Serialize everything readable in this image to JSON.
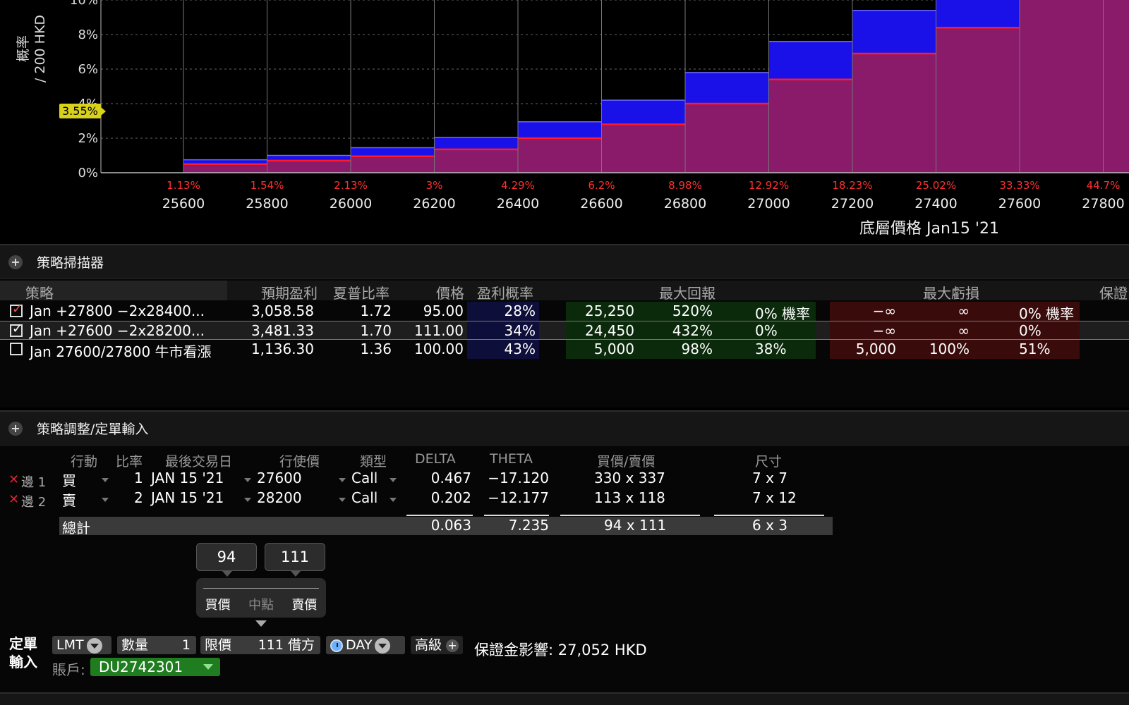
{
  "chart": {
    "y_label_line1": "概率",
    "y_label_line2": "/ 200 HKD",
    "pointer_value": "3.55%",
    "x_label": "底層價格 Jan15 '21",
    "y_ticks": [
      "0%",
      "2%",
      "4%",
      "6%",
      "8%",
      "10%"
    ],
    "x_ticks": [
      "25600",
      "25800",
      "26000",
      "26200",
      "26400",
      "26600",
      "26800",
      "27000",
      "27200",
      "27400",
      "27600",
      "27800"
    ],
    "cum_probs": [
      "1.13%",
      "1.54%",
      "2.13%",
      "3%",
      "4.29%",
      "6.2%",
      "8.98%",
      "12.92%",
      "18.23%",
      "25.02%",
      "33.33%",
      "44.7%"
    ],
    "colors": {
      "purple": "#8a1a6a",
      "blue": "#1a10e8",
      "red_line": "#ff1a2a",
      "grid": "#666",
      "cum_label": "#ff3030"
    }
  },
  "chart_data": {
    "type": "bar",
    "categories": [
      "25600",
      "25800",
      "26000",
      "26200",
      "26400",
      "26600",
      "26800",
      "27000",
      "27200",
      "27400",
      "27600"
    ],
    "series": [
      {
        "name": "",
        "values": [
          0.5,
          0.7,
          0.95,
          1.35,
          2.0,
          2.8,
          4.0,
          5.4,
          6.9,
          8.4,
          10.5
        ]
      },
      {
        "name": "",
        "values": [
          0.75,
          1.0,
          1.45,
          2.05,
          2.95,
          4.2,
          5.8,
          7.6,
          9.4,
          11.0,
          11.0
        ]
      }
    ],
    "ylim": [
      0,
      10
    ],
    "ylabel": "概率 / 200 HKD",
    "xlabel": "底層價格 Jan15 '21"
  },
  "scanner": {
    "title": "策略掃描器",
    "headers": {
      "strategy": "策略",
      "exp_profit": "預期盈利",
      "sharpe": "夏普比率",
      "price": "價格",
      "pop": "盈利概率",
      "max_return": "最大回報",
      "max_loss": "最大虧損",
      "margin": "保證"
    },
    "rows": [
      {
        "name": "Jan +27800 −2x28400...",
        "exp_profit": "3,058.58",
        "sharpe": "1.72",
        "price": "95.00",
        "pop": "28%",
        "ret_val": "25,250",
        "ret_pct": "520%",
        "ret_prob": "0% 機率",
        "loss_val": "−∞",
        "loss_pct": "∞",
        "loss_prob": "0% 機率",
        "checked": true
      },
      {
        "name": "Jan +27600 −2x28200...",
        "exp_profit": "3,481.33",
        "sharpe": "1.70",
        "price": "111.00",
        "pop": "34%",
        "ret_val": "24,450",
        "ret_pct": "432%",
        "ret_prob": "0%",
        "loss_val": "−∞",
        "loss_pct": "∞",
        "loss_prob": "0%",
        "checked": true
      },
      {
        "name": "Jan 27600/27800 牛市看漲",
        "exp_profit": "1,136.30",
        "sharpe": "1.36",
        "price": "100.00",
        "pop": "43%",
        "ret_val": "5,000",
        "ret_pct": "98%",
        "ret_prob": "38%",
        "loss_val": "5,000",
        "loss_pct": "100%",
        "loss_prob": "51%",
        "checked": false
      }
    ]
  },
  "order": {
    "title": "策略調整/定單輸入",
    "headers": {
      "action": "行動",
      "ratio": "比率",
      "last_trade": "最後交易日",
      "strike": "行使價",
      "type": "類型",
      "delta": "DELTA",
      "theta": "THETA",
      "bidask": "買價/賣價",
      "size": "尺寸"
    },
    "legs": [
      {
        "label": "邊 1",
        "action": "買",
        "ratio": "1",
        "date": "JAN 15 '21",
        "strike": "27600",
        "type": "Call",
        "delta": "0.467",
        "theta": "−17.120",
        "bidask": "330 x 337",
        "size": "7 x 7"
      },
      {
        "label": "邊 2",
        "action": "賣",
        "ratio": "2",
        "date": "JAN 15 '21",
        "strike": "28200",
        "type": "Call",
        "delta": "0.202",
        "theta": "−12.177",
        "bidask": "113 x 118",
        "size": "7 x 12"
      }
    ],
    "total": {
      "label": "總計",
      "delta": "0.063",
      "theta": "7.235",
      "bidask": "94 x 111",
      "size": "6 x 3"
    },
    "bid_box": "94",
    "ask_box": "111",
    "slider_bid": "買價",
    "slider_mid": "中點",
    "slider_ask": "賣價",
    "entry_label_1": "定單",
    "entry_label_2": "輸入",
    "order_type": "LMT",
    "qty_label": "數量",
    "qty_value": "1",
    "limit_label": "限價",
    "limit_value": "111 借方",
    "tif": "DAY",
    "advanced": "高級",
    "margin_impact": "保證金影響: 27,052 HKD",
    "account_label": "賬戶:",
    "account": "DU2742301"
  }
}
